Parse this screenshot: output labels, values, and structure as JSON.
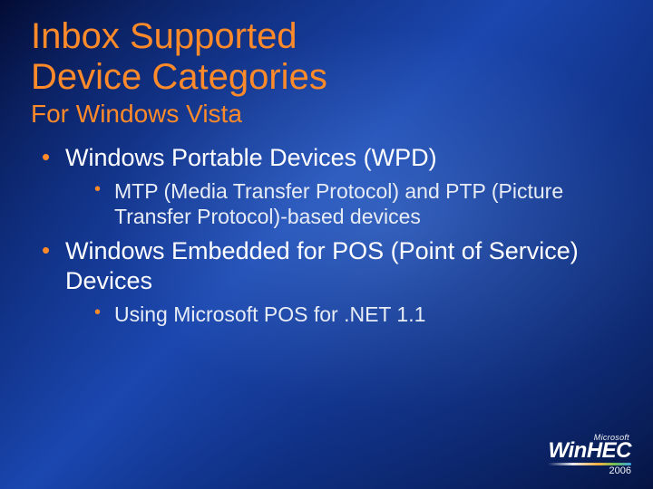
{
  "title_line1": "Inbox Supported",
  "title_line2": "Device Categories",
  "subtitle": "For Windows Vista",
  "bullets": [
    {
      "text": "Windows Portable Devices (WPD)",
      "children": [
        "MTP (Media Transfer Protocol) and PTP (Picture Transfer Protocol)-based devices"
      ]
    },
    {
      "text": "Windows Embedded for POS (Point of Service) Devices",
      "children": [
        "Using Microsoft POS for .NET 1.1"
      ]
    }
  ],
  "logo": {
    "vendor": "Microsoft",
    "brand_a": "Win",
    "brand_b": "HEC",
    "year": "2006"
  }
}
